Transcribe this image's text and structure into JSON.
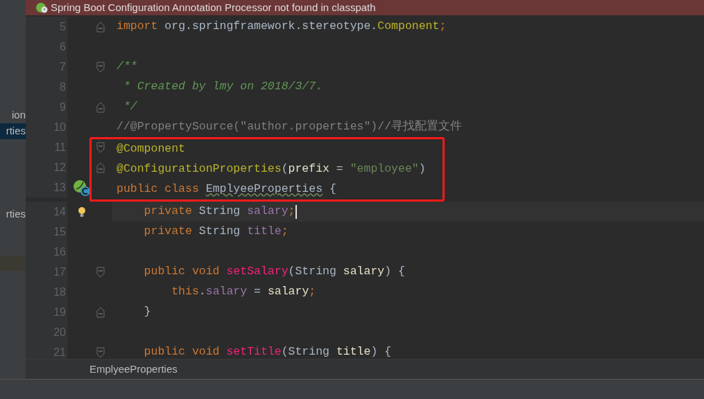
{
  "banner": {
    "message": "Spring Boot Configuration Annotation Processor not found in classpath"
  },
  "project_panel": {
    "items": [
      {
        "label": "ion",
        "selected": false
      },
      {
        "label": "rties",
        "selected": true
      },
      {
        "label": "rties",
        "selected": false
      }
    ]
  },
  "editor": {
    "lines": [
      {
        "number": "5",
        "fold": {
          "kind": "end"
        },
        "tokens": [
          {
            "kind": "keyword",
            "text": "import"
          },
          {
            "kind": "plain",
            "text": " org.springframework.stereotype."
          },
          {
            "kind": "annotation",
            "text": "Component"
          },
          {
            "kind": "keyword",
            "text": ";"
          }
        ]
      },
      {
        "number": "6"
      },
      {
        "number": "7",
        "fold": {
          "kind": "start"
        },
        "tokens": [
          {
            "kind": "doc",
            "text": "/**"
          }
        ]
      },
      {
        "number": "8",
        "tokens": [
          {
            "kind": "doc",
            "text": " * Created by lmy on 2018/3/7."
          }
        ]
      },
      {
        "number": "9",
        "fold": {
          "kind": "end"
        },
        "tokens": [
          {
            "kind": "doc",
            "text": " */"
          }
        ]
      },
      {
        "number": "10",
        "tokens": [
          {
            "kind": "comment",
            "text": "//@PropertySource(\"author.properties\")//寻找配置文件"
          }
        ]
      },
      {
        "number": "11",
        "fold": {
          "kind": "start"
        },
        "boxed": true,
        "tokens": [
          {
            "kind": "annotation",
            "text": "@Component"
          }
        ]
      },
      {
        "number": "12",
        "fold": {
          "kind": "end"
        },
        "boxed": true,
        "tokens": [
          {
            "kind": "annotation",
            "text": "@ConfigurationProperties"
          },
          {
            "kind": "plain",
            "text": "("
          },
          {
            "kind": "param",
            "text": "prefix"
          },
          {
            "kind": "plain",
            "text": " = "
          },
          {
            "kind": "string",
            "text": "\"employee\""
          },
          {
            "kind": "plain",
            "text": ")"
          }
        ]
      },
      {
        "number": "13",
        "boxed": true,
        "gutter_icon": {
          "kind": "spring"
        },
        "tokens": [
          {
            "kind": "keyword",
            "text": "public class "
          },
          {
            "kind": "typo",
            "text": "EmplyeeProperties"
          },
          {
            "kind": "plain",
            "text": " {"
          }
        ]
      },
      {
        "number": "14",
        "current": true,
        "gutter_icon": {
          "kind": "bulb"
        },
        "tokens": [
          {
            "kind": "keyword",
            "text": "    private "
          },
          {
            "kind": "plain",
            "text": "String "
          },
          {
            "kind": "field",
            "text": "salary"
          },
          {
            "kind": "keyword",
            "text": ";"
          }
        ]
      },
      {
        "number": "15",
        "tokens": [
          {
            "kind": "keyword",
            "text": "    private "
          },
          {
            "kind": "plain",
            "text": "String "
          },
          {
            "kind": "field",
            "text": "title"
          },
          {
            "kind": "keyword",
            "text": ";"
          }
        ]
      },
      {
        "number": "16"
      },
      {
        "number": "17",
        "fold": {
          "kind": "start"
        },
        "tokens": [
          {
            "kind": "keyword",
            "text": "    public void "
          },
          {
            "kind": "method",
            "text": "setSalary"
          },
          {
            "kind": "plain",
            "text": "(String "
          },
          {
            "kind": "param",
            "text": "salary"
          },
          {
            "kind": "plain",
            "text": ") {"
          }
        ]
      },
      {
        "number": "18",
        "tokens": [
          {
            "kind": "keyword",
            "text": "        this"
          },
          {
            "kind": "plain",
            "text": "."
          },
          {
            "kind": "field",
            "text": "salary"
          },
          {
            "kind": "plain",
            "text": " = "
          },
          {
            "kind": "param",
            "text": "salary"
          },
          {
            "kind": "keyword",
            "text": ";"
          }
        ]
      },
      {
        "number": "19",
        "fold": {
          "kind": "end"
        },
        "tokens": [
          {
            "kind": "plain",
            "text": "    }"
          }
        ]
      },
      {
        "number": "20"
      },
      {
        "number": "21",
        "fold": {
          "kind": "start"
        },
        "tokens": [
          {
            "kind": "keyword",
            "text": "    public void "
          },
          {
            "kind": "method",
            "text": "setTitle"
          },
          {
            "kind": "plain",
            "text": "(String "
          },
          {
            "kind": "param",
            "text": "title"
          },
          {
            "kind": "plain",
            "text": ") {"
          }
        ]
      }
    ]
  },
  "breadcrumb": {
    "label": "EmplyeeProperties"
  }
}
